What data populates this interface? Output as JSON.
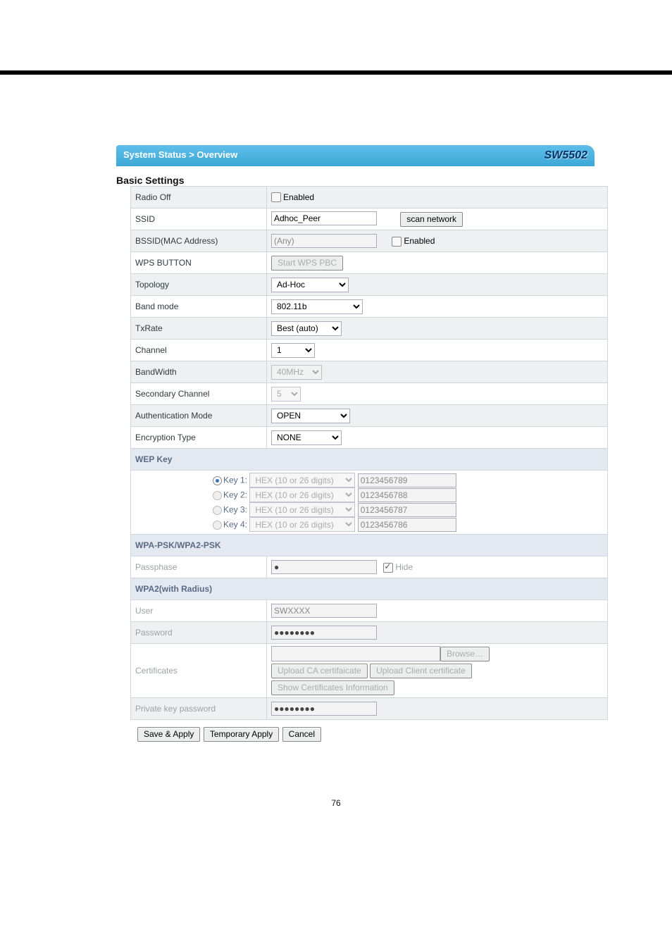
{
  "header": {
    "breadcrumb": "System Status > Overview",
    "brand": "SW5502"
  },
  "section_titles": {
    "basic": "Basic Settings"
  },
  "fields": {
    "radio_off": {
      "label": "Radio Off",
      "value": "Enabled"
    },
    "ssid": {
      "label": "SSID",
      "value": "Adhoc_Peer",
      "scan_btn": "scan network"
    },
    "bssid": {
      "label": "BSSID(MAC Address)",
      "value": "(Any)",
      "enable_label": "Enabled"
    },
    "wps": {
      "label": "WPS BUTTON",
      "btn": "Start WPS PBC"
    },
    "topology": {
      "label": "Topology",
      "value": "Ad-Hoc"
    },
    "band": {
      "label": "Band mode",
      "value": "802.11b"
    },
    "txrate": {
      "label": "TxRate",
      "value": "Best (auto)"
    },
    "channel": {
      "label": "Channel",
      "value": "1"
    },
    "bandwidth": {
      "label": "BandWidth",
      "value": "40MHz"
    },
    "secchan": {
      "label": "Secondary Channel",
      "value": "5"
    },
    "auth": {
      "label": "Authentication Mode",
      "value": "OPEN"
    },
    "enc": {
      "label": "Encryption Type",
      "value": "NONE"
    }
  },
  "wep": {
    "header": "WEP Key",
    "keys": [
      {
        "label": "Key 1:",
        "fmt": "HEX (10 or 26 digits)",
        "value": "0123456789",
        "selected": true
      },
      {
        "label": "Key 2:",
        "fmt": "HEX (10 or 26 digits)",
        "value": "0123456788",
        "selected": false
      },
      {
        "label": "Key 3:",
        "fmt": "HEX (10 or 26 digits)",
        "value": "0123456787",
        "selected": false
      },
      {
        "label": "Key 4:",
        "fmt": "HEX (10 or 26 digits)",
        "value": "0123456786",
        "selected": false
      }
    ]
  },
  "wpapsk": {
    "header": "WPA-PSK/WPA2-PSK",
    "passphase_label": "Passphase",
    "passphase_value": "●",
    "hide_label": "Hide"
  },
  "wpa2r": {
    "header": "WPA2(with Radius)",
    "user_label": "User",
    "user_value": "SWXXXX",
    "pwd_label": "Password",
    "pwd_value": "●●●●●●●●",
    "cert_label": "Certificates",
    "browse_btn": "Browse…",
    "upload_ca_btn": "Upload CA certifaicate",
    "upload_client_btn": "Upload Client certificate",
    "show_certs_btn": "Show Certificates Information",
    "pk_label": "Private key password",
    "pk_value": "●●●●●●●●"
  },
  "buttons": {
    "save": "Save & Apply",
    "temp": "Temporary Apply",
    "cancel": "Cancel"
  },
  "page_number": "76"
}
